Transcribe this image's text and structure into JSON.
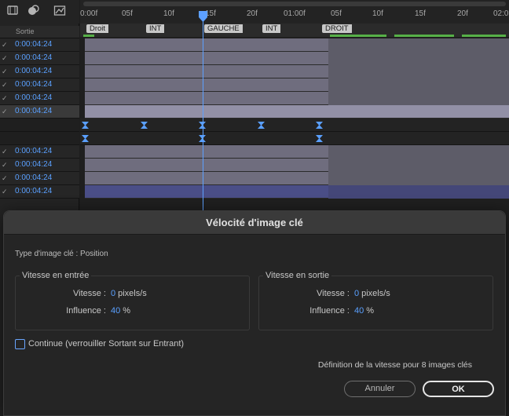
{
  "left_panel": {
    "column_header": "Sortie",
    "rows_top": [
      "0:00:04:24",
      "0:00:04:24",
      "0:00:04:24",
      "0:00:04:24",
      "0:00:04:24",
      "0:00:04:24"
    ],
    "rows_bottom": [
      "0:00:04:24",
      "0:00:04:24",
      "0:00:04:24",
      "0:00:04:24"
    ]
  },
  "ruler": {
    "labels": [
      "0:00f",
      "05f",
      "10f",
      "15f",
      "20f",
      "01:00f",
      "05f",
      "10f",
      "15f",
      "20f",
      "02:0"
    ]
  },
  "markers": [
    "Droit",
    "INT",
    "GAUCHE",
    "INT",
    "DROIT"
  ],
  "dialog": {
    "title": "Vélocité d'image clé",
    "type_label": "Type d'image clé : Position",
    "incoming": {
      "title": "Vitesse en entrée",
      "speed_label": "Vitesse :",
      "speed_value": "0",
      "speed_unit": "pixels/s",
      "influence_label": "Influence :",
      "influence_value": "40",
      "influence_unit": "%"
    },
    "outgoing": {
      "title": "Vitesse en sortie",
      "speed_label": "Vitesse :",
      "speed_value": "0",
      "speed_unit": "pixels/s",
      "influence_label": "Influence :",
      "influence_value": "40",
      "influence_unit": "%"
    },
    "continuous_label": "Continue (verrouiller Sortant sur Entrant)",
    "continuous_checked": false,
    "summary": "Définition de la vitesse pour 8 images clés",
    "cancel_label": "Annuler",
    "ok_label": "OK"
  },
  "colors": {
    "accent": "#5aa0ff",
    "layer_bar": "#6f6d7e",
    "layer_bar_blue": "#4a4e87",
    "marker_green": "#57b048"
  }
}
